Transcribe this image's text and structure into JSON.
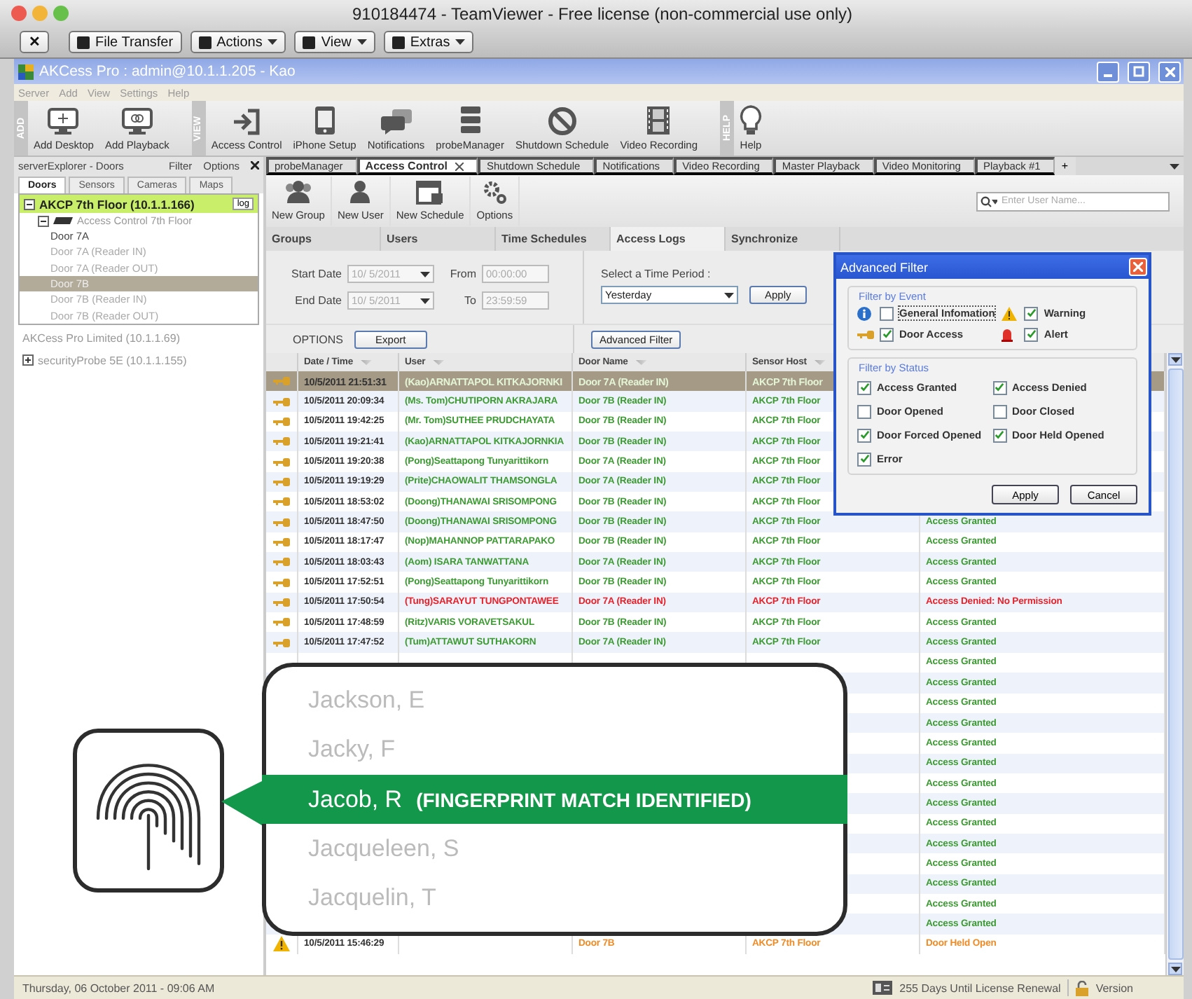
{
  "mac_window": {
    "title": "910184474 - TeamViewer - Free license (non-commercial use only)",
    "close_button": "✕",
    "toolbar": [
      {
        "label": "File Transfer",
        "dropdown": false
      },
      {
        "label": "Actions",
        "dropdown": true
      },
      {
        "label": "View",
        "dropdown": true
      },
      {
        "label": "Extras",
        "dropdown": true
      }
    ]
  },
  "app": {
    "title": "AKCess Pro : admin@10.1.1.205 - Kao",
    "menu": [
      "Server",
      "Add",
      "View",
      "Settings",
      "Help"
    ],
    "toolbar_groups": [
      {
        "label": "ADD",
        "items": [
          "Add Desktop",
          "Add Playback"
        ]
      },
      {
        "label": "VIEW",
        "items": [
          "Access Control",
          "iPhone Setup",
          "Notifications",
          "probeManager",
          "Shutdown Schedule",
          "Video Recording"
        ]
      },
      {
        "label": "HELP",
        "items": [
          "Help"
        ]
      }
    ]
  },
  "explorer": {
    "title": "serverExplorer - Doors",
    "links": [
      "Filter",
      "Options"
    ],
    "tabs": [
      {
        "label": "Doors",
        "selected": true
      },
      {
        "label": "Sensors",
        "selected": false
      },
      {
        "label": "Cameras",
        "selected": false
      },
      {
        "label": "Maps",
        "selected": false
      }
    ],
    "tree": [
      {
        "label": "AKCP 7th Floor (10.1.1.166)",
        "highlighted": true,
        "expanded": true,
        "button": "log",
        "children": [
          {
            "label": "Access Control 7th Floor",
            "expanded": true,
            "children": [
              {
                "label": "Door 7A",
                "selected": false,
                "dimmed": false
              },
              {
                "label": "Door 7A (Reader IN)",
                "selected": false,
                "dimmed": true
              },
              {
                "label": "Door 7A (Reader OUT)",
                "selected": false,
                "dimmed": true
              },
              {
                "label": "Door 7B",
                "selected": true,
                "dimmed": true
              },
              {
                "label": "Door 7B (Reader IN)",
                "selected": false,
                "dimmed": true
              },
              {
                "label": "Door 7B (Reader OUT)",
                "selected": false,
                "dimmed": true
              }
            ]
          }
        ]
      },
      {
        "label": "AKCess Pro Limited (10.1.1.69)",
        "highlighted": false
      },
      {
        "label": "securityProbe 5E (10.1.1.155)",
        "highlighted": false,
        "expanded": false
      }
    ]
  },
  "doc_tabs": [
    {
      "label": "probeManager",
      "selected": false
    },
    {
      "label": "Access Control",
      "selected": true
    },
    {
      "label": "Shutdown Schedule",
      "selected": false
    },
    {
      "label": "Notifications",
      "selected": false
    },
    {
      "label": "Video Recording",
      "selected": false
    },
    {
      "label": "Master Playback",
      "selected": false
    },
    {
      "label": "Video Monitoring",
      "selected": false
    },
    {
      "label": "Playback #1",
      "selected": false
    }
  ],
  "new_tab_button": "+",
  "tools": [
    "New Group",
    "New User",
    "New Schedule",
    "Options"
  ],
  "search": {
    "placeholder": "Enter User Name..."
  },
  "sub_tabs": [
    {
      "label": "Groups",
      "selected": false
    },
    {
      "label": "Users",
      "selected": false
    },
    {
      "label": "Time Schedules",
      "selected": false
    },
    {
      "label": "Access Logs",
      "selected": true
    },
    {
      "label": "Synchronize",
      "selected": false
    }
  ],
  "filters": {
    "start_label": "Start Date",
    "start_value": "10/ 5/2011",
    "from_label": "From",
    "from_value": "00:00:00",
    "end_label": "End Date",
    "end_value": "10/ 5/2011",
    "to_label": "To",
    "to_value": "23:59:59",
    "disabled": true,
    "period_label": "Select a Time Period :",
    "period_value": "Yesterday",
    "apply": "Apply",
    "options_label": "OPTIONS",
    "export": "Export",
    "advanced": "Advanced Filter"
  },
  "table": {
    "columns": [
      "Date / Time",
      "User",
      "Door Name",
      "Sensor Host"
    ],
    "rows": [
      {
        "kind": "access",
        "selected": true,
        "time": "10/5/2011 21:51:31",
        "user": "(Kao)ARNATTAPOL KITKAJORNKI",
        "door": "Door 7A (Reader IN)",
        "host": "AKCP 7th Floor"
      },
      {
        "kind": "access",
        "selected": false,
        "color": "#3c9a32",
        "time": "10/5/2011 20:09:34",
        "user": "(Ms. Tom)CHUTIPORN AKRAJARA",
        "door": "Door 7B (Reader IN)",
        "host": "AKCP 7th Floor"
      },
      {
        "kind": "access",
        "selected": false,
        "color": "#3c9a32",
        "time": "10/5/2011 19:42:25",
        "user": "(Mr. Tom)SUTHEE PRUDCHAYATA",
        "door": "Door 7B (Reader IN)",
        "host": "AKCP 7th Floor"
      },
      {
        "kind": "access",
        "selected": false,
        "color": "#3c9a32",
        "time": "10/5/2011 19:21:41",
        "user": "(Kao)ARNATTAPOL KITKAJORNKIA",
        "door": "Door 7B (Reader IN)",
        "host": "AKCP 7th Floor"
      },
      {
        "kind": "access",
        "selected": false,
        "color": "#3c9a32",
        "time": "10/5/2011 19:20:38",
        "user": "(Pong)Seattapong Tunyarittikorn",
        "door": "Door 7A (Reader IN)",
        "host": "AKCP 7th Floor"
      },
      {
        "kind": "access",
        "selected": false,
        "color": "#3c9a32",
        "time": "10/5/2011 19:19:29",
        "user": "(Prite)CHAOWALIT THAMSONGLA",
        "door": "Door 7A (Reader IN)",
        "host": "AKCP 7th Floor"
      },
      {
        "kind": "access",
        "selected": false,
        "color": "#3c9a32",
        "time": "10/5/2011 18:53:02",
        "user": "(Doong)THANAWAI SRISOMPONG",
        "door": "Door 7B (Reader IN)",
        "host": "AKCP 7th Floor"
      },
      {
        "kind": "access",
        "selected": false,
        "color": "#3c9a32",
        "time": "10/5/2011 18:47:50",
        "user": "(Doong)THANAWAI SRISOMPONG",
        "door": "Door 7B (Reader IN)",
        "host": "AKCP 7th Floor",
        "status": "Access Granted"
      },
      {
        "kind": "access",
        "selected": false,
        "color": "#3c9a32",
        "time": "10/5/2011 18:17:47",
        "user": "(Nop)MAHANNOP PATTARAPAKO",
        "door": "Door 7B (Reader IN)",
        "host": "AKCP 7th Floor",
        "status": "Access Granted"
      },
      {
        "kind": "access",
        "selected": false,
        "color": "#3c9a32",
        "time": "10/5/2011 18:03:43",
        "user": "(Aom) ISARA TANWATTANA",
        "door": "Door 7A (Reader IN)",
        "host": "AKCP 7th Floor",
        "status": "Access Granted"
      },
      {
        "kind": "access",
        "selected": false,
        "color": "#3c9a32",
        "time": "10/5/2011 17:52:51",
        "user": "(Pong)Seattapong Tunyarittikorn",
        "door": "Door 7B (Reader IN)",
        "host": "AKCP 7th Floor",
        "status": "Access Granted"
      },
      {
        "kind": "access",
        "selected": false,
        "color": "#e8202a",
        "time": "10/5/2011 17:50:54",
        "user": "(Tung)SARAYUT TUNGPONTAWEE",
        "door": "Door 7A (Reader IN)",
        "host": "AKCP 7th Floor",
        "status": "Access Denied: No Permission"
      },
      {
        "kind": "access",
        "selected": false,
        "color": "#3c9a32",
        "time": "10/5/2011 17:48:59",
        "user": "(Ritz)VARIS VORAVETSAKUL",
        "door": "Door 7B (Reader IN)",
        "host": "AKCP 7th Floor",
        "status": "Access Granted"
      },
      {
        "kind": "access",
        "selected": false,
        "color": "#3c9a32",
        "time": "10/5/2011 17:47:52",
        "user": "(Tum)ATTAWUT SUTHAKORN",
        "door": "Door 7A (Reader IN)",
        "host": "AKCP 7th Floor",
        "status": "Access Granted"
      },
      {
        "selected": false,
        "color": "#3c9a32",
        "status": "Access Granted"
      },
      {
        "selected": false,
        "color": "#3c9a32",
        "status": "Access Granted"
      },
      {
        "selected": false,
        "color": "#3c9a32",
        "status": "Access Granted"
      },
      {
        "selected": false,
        "color": "#3c9a32",
        "status": "Access Granted"
      },
      {
        "selected": false,
        "color": "#3c9a32",
        "status": "Access Granted"
      },
      {
        "selected": false,
        "color": "#3c9a32",
        "status": "Access Granted"
      },
      {
        "selected": false,
        "color": "#3c9a32",
        "status": "Access Granted"
      },
      {
        "selected": false,
        "color": "#3c9a32",
        "status": "Access Granted"
      },
      {
        "selected": false,
        "color": "#3c9a32",
        "status": "Access Granted"
      },
      {
        "selected": false,
        "color": "#3c9a32",
        "status": "Access Granted"
      },
      {
        "selected": false,
        "color": "#3c9a32",
        "status": "Access Granted"
      },
      {
        "selected": false,
        "color": "#3c9a32",
        "status": "Access Granted"
      },
      {
        "selected": false,
        "color": "#3c9a32",
        "status": "Access Granted"
      },
      {
        "selected": false,
        "color": "#3c9a32",
        "status": "Access Granted"
      },
      {
        "kind": "warning",
        "selected": false,
        "color": "#f08a24",
        "time": "10/5/2011 15:46:29",
        "door": "Door 7B",
        "host": "AKCP 7th Floor",
        "status": "Door Held Open"
      }
    ]
  },
  "dialog": {
    "title": "Advanced Filter",
    "event_group": "Filter by Event",
    "events": [
      {
        "label": "General Infomation",
        "checked": false,
        "focused": true
      },
      {
        "label": "Warning",
        "checked": true,
        "focused": false
      },
      {
        "label": "Door Access",
        "checked": true,
        "focused": false
      },
      {
        "label": "Alert",
        "checked": true,
        "focused": false
      }
    ],
    "status_group": "Filter by Status",
    "statuses": [
      {
        "label": "Access Granted",
        "checked": true
      },
      {
        "label": "Access Denied",
        "checked": true
      },
      {
        "label": "Door Opened",
        "checked": false
      },
      {
        "label": "Door Closed",
        "checked": false
      },
      {
        "label": "Door Forced Opened",
        "checked": true
      },
      {
        "label": "Door Held Opened",
        "checked": true
      },
      {
        "label": "Error",
        "checked": true
      }
    ],
    "buttons": [
      "Apply",
      "Cancel"
    ]
  },
  "callout": {
    "names": [
      {
        "name": "Jackson, E",
        "selected": false
      },
      {
        "name": "Jacky, F",
        "selected": false
      },
      {
        "name": "Jacob, R",
        "note": "(FINGERPRINT MATCH IDENTIFIED)",
        "selected": true
      },
      {
        "name": "Jacqueleen, S",
        "selected": false
      },
      {
        "name": "Jacquelin, T",
        "selected": false
      }
    ]
  },
  "status_bar": {
    "date": "Thursday, 06 October 2011 - 09:06 AM",
    "license": "255 Days Until License Renewal",
    "version": "Version"
  }
}
